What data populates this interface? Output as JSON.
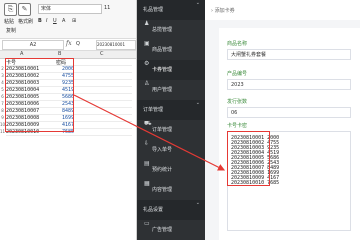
{
  "excel": {
    "ribbon": {
      "paste": "粘贴",
      "format_painter": "格式刷",
      "copy": "复制",
      "font_name": "宋体",
      "font_size": "11"
    },
    "name_box": "A2",
    "formula_value": "20230810001",
    "column_headers": [
      "A",
      "B",
      "C"
    ],
    "header_row": {
      "a": "卡号",
      "b": "密码"
    },
    "rows": [
      {
        "row": "2",
        "card": "20230810001",
        "pwd": "2000"
      },
      {
        "row": "3",
        "card": "20230810002",
        "pwd": "4755"
      },
      {
        "row": "4",
        "card": "20230810003",
        "pwd": "9235"
      },
      {
        "row": "5",
        "card": "20230810004",
        "pwd": "4519"
      },
      {
        "row": "6",
        "card": "20230810005",
        "pwd": "5686"
      },
      {
        "row": "7",
        "card": "20230810006",
        "pwd": "2543"
      },
      {
        "row": "8",
        "card": "20230810007",
        "pwd": "8489"
      },
      {
        "row": "9",
        "card": "20230810008",
        "pwd": "1699"
      },
      {
        "row": "10",
        "card": "20230810009",
        "pwd": "4167"
      },
      {
        "row": "11",
        "card": "20230810010",
        "pwd": "7685"
      }
    ]
  },
  "sidebar": {
    "items": [
      {
        "key": "gift-manage",
        "label": "礼品管理",
        "icon": "chevron",
        "type": "group"
      },
      {
        "key": "gift-total",
        "label": "总揽管理",
        "icon": "user-icon",
        "type": "item"
      },
      {
        "key": "goods",
        "label": "商品管理",
        "icon": "bag-icon",
        "type": "item"
      },
      {
        "key": "card",
        "label": "卡券管理",
        "icon": "gear-icon",
        "type": "active"
      },
      {
        "key": "users",
        "label": "用户管理",
        "icon": "users-icon",
        "type": "item"
      },
      {
        "key": "orders",
        "label": "订单管理",
        "icon": "chevron",
        "type": "group"
      },
      {
        "key": "order-manage",
        "label": "订单管理",
        "icon": "cart-icon",
        "type": "item"
      },
      {
        "key": "import",
        "label": "导入单号",
        "icon": "import-icon",
        "type": "item"
      },
      {
        "key": "stats",
        "label": "预约统计",
        "icon": "chart-icon",
        "type": "item"
      },
      {
        "key": "content",
        "label": "内容管理",
        "icon": "grid-icon",
        "type": "item"
      },
      {
        "key": "gift-settings",
        "label": "礼品设置",
        "icon": "chevron",
        "type": "group"
      },
      {
        "key": "ads",
        "label": "广告管理",
        "icon": "screen-icon",
        "type": "item"
      }
    ]
  },
  "topbar": {
    "breadcrumb": "添加卡券"
  },
  "form": {
    "name_label": "商品名称",
    "name_value": "大闸蟹礼券套餐",
    "code_label": "产品编号",
    "code_value": "2023",
    "count_label": "发行张数",
    "count_value": "06",
    "cards_label": "卡号卡密",
    "cards": [
      "20230810001  2000",
      "20230810002  4755",
      "20230810003  9235",
      "20230810004  4519",
      "20230810005  5686",
      "20230810006  2543",
      "20230810007  8489",
      "20230810008  1699",
      "20230810009  4167",
      "20230810010  7685"
    ]
  },
  "colors": {
    "sidebar_bg": "#2e3134",
    "highlight": "#e53935",
    "label_green": "#3a8a3a"
  }
}
